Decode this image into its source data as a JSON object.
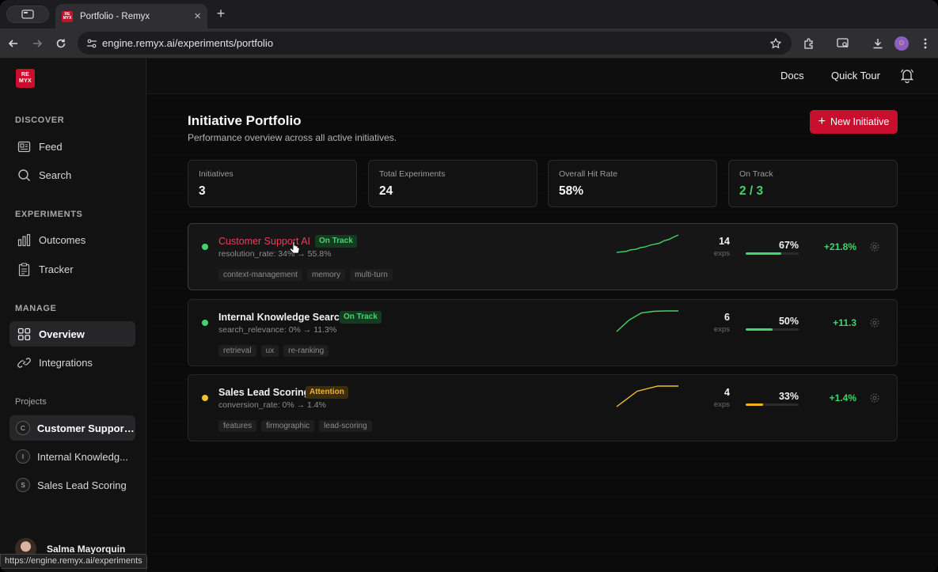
{
  "browser": {
    "tab_title": "Portfolio - Remyx",
    "url": "engine.remyx.ai/experiments/portfolio",
    "status_url": "https://engine.remyx.ai/experiments"
  },
  "app": {
    "logo_text_top": "RE",
    "logo_text_bottom": "MYX",
    "brand_color": "#c8102e"
  },
  "sidebar": {
    "sections": [
      {
        "label": "DISCOVER",
        "items": [
          {
            "label": "Feed",
            "icon": "feed-icon"
          },
          {
            "label": "Search",
            "icon": "search-icon"
          }
        ]
      },
      {
        "label": "EXPERIMENTS",
        "items": [
          {
            "label": "Outcomes",
            "icon": "bar-chart-icon"
          },
          {
            "label": "Tracker",
            "icon": "clipboard-icon"
          }
        ]
      },
      {
        "label": "MANAGE",
        "items": [
          {
            "label": "Overview",
            "icon": "grid-icon",
            "active": true
          },
          {
            "label": "Integrations",
            "icon": "link-icon"
          }
        ]
      }
    ],
    "projects_label": "Projects",
    "projects": [
      {
        "badge": "C",
        "label": "Customer Support...",
        "active": true
      },
      {
        "badge": "I",
        "label": "Internal Knowledg..."
      },
      {
        "badge": "S",
        "label": "Sales Lead Scoring"
      }
    ],
    "user_name": "Salma Mayorquin"
  },
  "topbar": {
    "docs": "Docs",
    "quick_tour": "Quick Tour"
  },
  "header": {
    "title": "Initiative Portfolio",
    "subtitle": "Performance overview across all active initiatives.",
    "new_button": "New Initiative"
  },
  "stats": [
    {
      "label": "Initiatives",
      "value": "3"
    },
    {
      "label": "Total Experiments",
      "value": "24"
    },
    {
      "label": "Overall Hit Rate",
      "value": "58%"
    },
    {
      "label": "On Track",
      "value": "2 / 3",
      "highlight": true
    }
  ],
  "initiatives": [
    {
      "name": "Customer Support AI",
      "status": "On Track",
      "status_color": "#49d36e",
      "metric": "resolution_rate: 34% → 55.8%",
      "tags": [
        "context-management",
        "memory",
        "multi-turn"
      ],
      "exps": "14",
      "exps_label": "exps",
      "hit_rate_text": "67%",
      "hit_rate": 0.67,
      "delta": "+21.8%",
      "spark_color": "#43d36a",
      "spark": [
        0.15,
        0.18,
        0.2,
        0.28,
        0.3,
        0.38,
        0.42,
        0.5,
        0.55,
        0.6,
        0.72,
        0.78,
        0.9,
        1.0
      ]
    },
    {
      "name": "Internal Knowledge Search",
      "status": "On Track",
      "status_color": "#49d36e",
      "metric": "search_relevance: 0% → 11.3%",
      "tags": [
        "retrieval",
        "ux",
        "re-ranking"
      ],
      "exps": "6",
      "exps_label": "exps",
      "hit_rate_text": "50%",
      "hit_rate": 0.5,
      "delta": "+11.3",
      "spark_color": "#43d36a",
      "spark": [
        0.0,
        0.55,
        0.9,
        0.98,
        1.0,
        1.0
      ]
    },
    {
      "name": "Sales Lead Scoring",
      "status": "Attention",
      "status_color": "#f2b41c",
      "metric": "conversion_rate: 0% → 1.4%",
      "tags": [
        "features",
        "firmographic",
        "lead-scoring"
      ],
      "exps": "4",
      "exps_label": "exps",
      "hit_rate_text": "33%",
      "hit_rate": 0.33,
      "delta": "+1.4%",
      "spark_color": "#f2c12e",
      "spark": [
        0.0,
        0.75,
        1.0,
        1.0
      ]
    }
  ]
}
